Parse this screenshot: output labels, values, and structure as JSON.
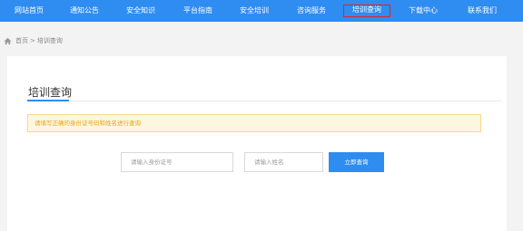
{
  "nav": {
    "items": [
      {
        "label": "网站首页"
      },
      {
        "label": "通知公告"
      },
      {
        "label": "安全知识"
      },
      {
        "label": "平台指南"
      },
      {
        "label": "安全培训"
      },
      {
        "label": "咨询服务"
      },
      {
        "label": "培训查询"
      },
      {
        "label": "下载中心"
      },
      {
        "label": "联系我们"
      }
    ],
    "active_index": 6,
    "color": "#2f8cf0"
  },
  "breadcrumb": {
    "icon": "home-icon",
    "home": "首页",
    "separator": ">",
    "current": "培训查询"
  },
  "page": {
    "title": "培训查询",
    "notice": "请填写正确的身份证号码和姓名进行查询"
  },
  "form": {
    "id_placeholder": "请输入身份证号",
    "name_placeholder": "请输入姓名",
    "submit_label": "立即查询"
  },
  "colors": {
    "accent": "#2f8cf0",
    "notice_bg": "#fff6df",
    "notice_text": "#e8a31a",
    "active_outline": "#e02424"
  }
}
